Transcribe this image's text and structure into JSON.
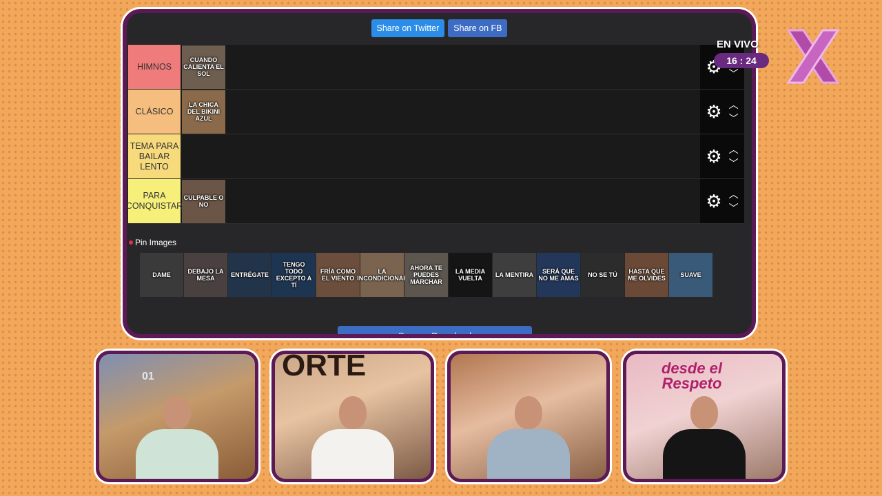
{
  "share": {
    "twitter": "Share on Twitter",
    "facebook": "Share on FB"
  },
  "tiers": [
    {
      "label": "HIMNOS",
      "color": "#f07b7b",
      "items": [
        {
          "text": "CUANDO CALIENTA EL SOL",
          "bg": "#6e5e50"
        }
      ]
    },
    {
      "label": "CLÁSICO",
      "color": "#f5be7e",
      "items": [
        {
          "text": "LA CHICA DEL BIKINI AZUL",
          "bg": "#8a6a4a"
        }
      ]
    },
    {
      "label": "TEMA PARA BAILAR LENTO",
      "color": "#f7da7c",
      "items": []
    },
    {
      "label": "PARA CONQUISTAR",
      "color": "#f6f07a",
      "items": [
        {
          "text": "CULPABLE O NO",
          "bg": "#6a5546"
        }
      ]
    }
  ],
  "pin_label": "Pin Images",
  "pinned": [
    {
      "text": "DAME",
      "bg": "#3a3a3a"
    },
    {
      "text": "DEBAJO LA MESA",
      "bg": "#4a4040"
    },
    {
      "text": "ENTRÉGATE",
      "bg": "#22344a"
    },
    {
      "text": "TENGO TODO EXCEPTO A TÍ",
      "bg": "#1e3552"
    },
    {
      "text": "FRÍA COMO EL VIENTO",
      "bg": "#6b4f3c"
    },
    {
      "text": "LA INCONDICIONAL",
      "bg": "#7a6450"
    },
    {
      "text": "AHORA TE PUEDES MARCHAR",
      "bg": "#5c564f"
    },
    {
      "text": "LA MEDIA VUELTA",
      "bg": "#151515"
    },
    {
      "text": "LA MENTIRA",
      "bg": "#3e3e3e"
    },
    {
      "text": "SERÁ QUE NO ME AMAS",
      "bg": "#23375a"
    },
    {
      "text": "NO SE TÚ",
      "bg": "#2c2c2c"
    },
    {
      "text": "HASTA QUE ME OLVIDES",
      "bg": "#6a4a36"
    },
    {
      "text": "SUAVE",
      "bg": "#3a5a7a"
    }
  ],
  "save_button": "Save or Download",
  "live": {
    "label": "EN VIVO",
    "time": "16 : 24"
  },
  "cams": [
    {
      "shirt": "#cfe3d6",
      "overlay": "01"
    },
    {
      "shirt": "#f4f2ee",
      "overlay": "ORTE"
    },
    {
      "shirt": "#9fb3c4",
      "overlay": ""
    },
    {
      "shirt": "#151515",
      "overlay": "desde el Respeto"
    }
  ],
  "icons": {
    "gear": "gear-icon",
    "up": "chevron-up-icon",
    "down": "chevron-down-icon",
    "pin": "pin-icon",
    "logo": "x-logo-icon"
  }
}
